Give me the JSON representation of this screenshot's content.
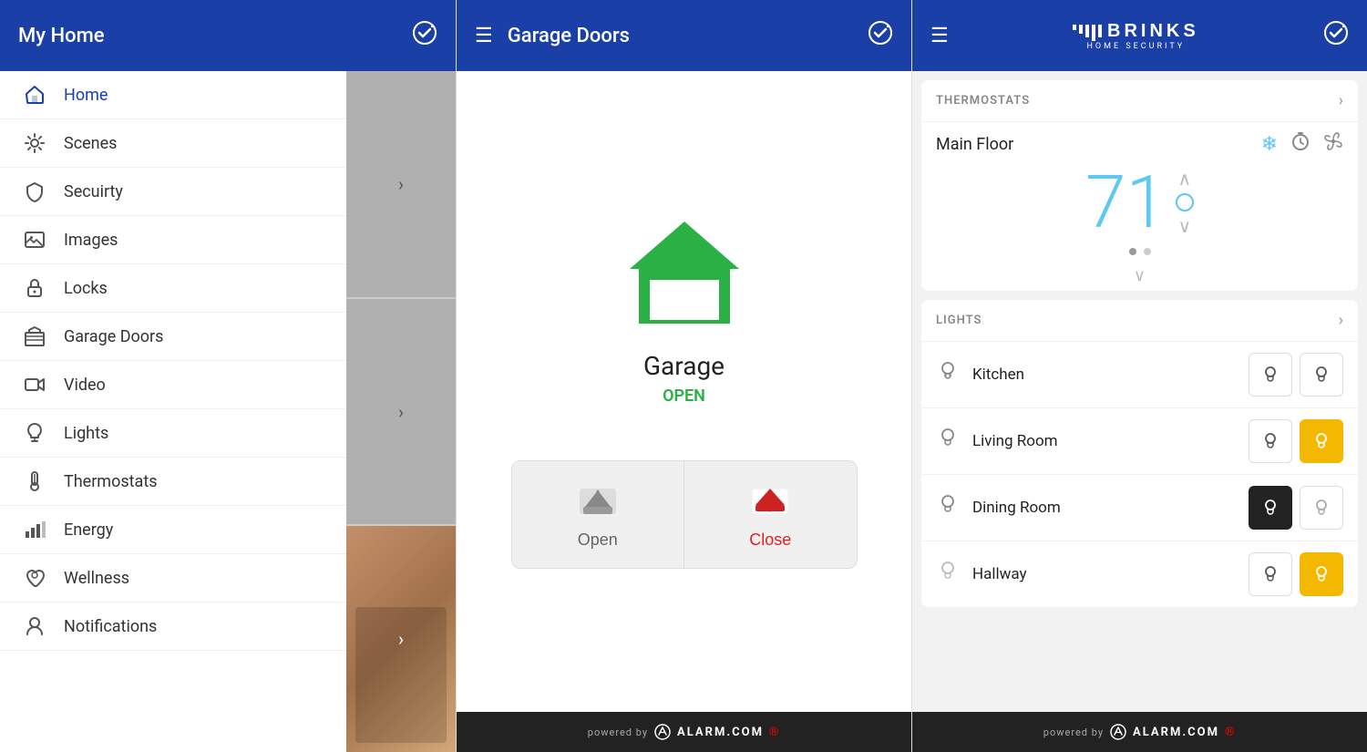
{
  "panel1": {
    "header": {
      "title": "My Home",
      "icon": "☑"
    },
    "menu": [
      {
        "id": "home",
        "label": "Home",
        "icon": "🏠",
        "active": true
      },
      {
        "id": "scenes",
        "label": "Scenes",
        "icon": "⚙"
      },
      {
        "id": "security",
        "label": "Secuirty",
        "icon": "🛡"
      },
      {
        "id": "images",
        "label": "Images",
        "icon": "🖼"
      },
      {
        "id": "locks",
        "label": "Locks",
        "icon": "🔒"
      },
      {
        "id": "garage",
        "label": "Garage Doors",
        "icon": "🏪"
      },
      {
        "id": "video",
        "label": "Video",
        "icon": "📹"
      },
      {
        "id": "lights",
        "label": "Lights",
        "icon": "💡"
      },
      {
        "id": "thermostats",
        "label": "Thermostats",
        "icon": "🌡"
      },
      {
        "id": "energy",
        "label": "Energy",
        "icon": "📊"
      },
      {
        "id": "wellness",
        "label": "Wellness",
        "icon": "❤"
      },
      {
        "id": "notifications",
        "label": "Notifications",
        "icon": "👤"
      }
    ]
  },
  "panel2": {
    "header": {
      "title": "Garage Doors",
      "hamburger": "☰",
      "icon": "☑"
    },
    "garage": {
      "name": "Garage",
      "status": "OPEN",
      "open_label": "Open",
      "close_label": "Close"
    },
    "footer": {
      "powered_by": "powered by",
      "brand": "ALARM.COM"
    }
  },
  "panel3": {
    "header": {
      "hamburger": "☰",
      "icon": "☑",
      "logo_name": "BRINKS",
      "logo_sub": "HOME SECURITY"
    },
    "thermostats": {
      "section_title": "THERMOSTATS",
      "main_floor": "Main Floor",
      "temperature": "71",
      "degree_symbol": "°"
    },
    "lights": {
      "section_title": "LIGHTS",
      "items": [
        {
          "name": "Kitchen",
          "off_state": "off",
          "on_state": "off"
        },
        {
          "name": "Living Room",
          "off_state": "off",
          "on_state": "on"
        },
        {
          "name": "Dining Room",
          "off_state": "off_dark",
          "on_state": "off"
        },
        {
          "name": "Hallway",
          "off_state": "off",
          "on_state": "on"
        }
      ]
    },
    "footer": {
      "powered_by": "powered by",
      "brand": "ALARM.COM"
    }
  }
}
